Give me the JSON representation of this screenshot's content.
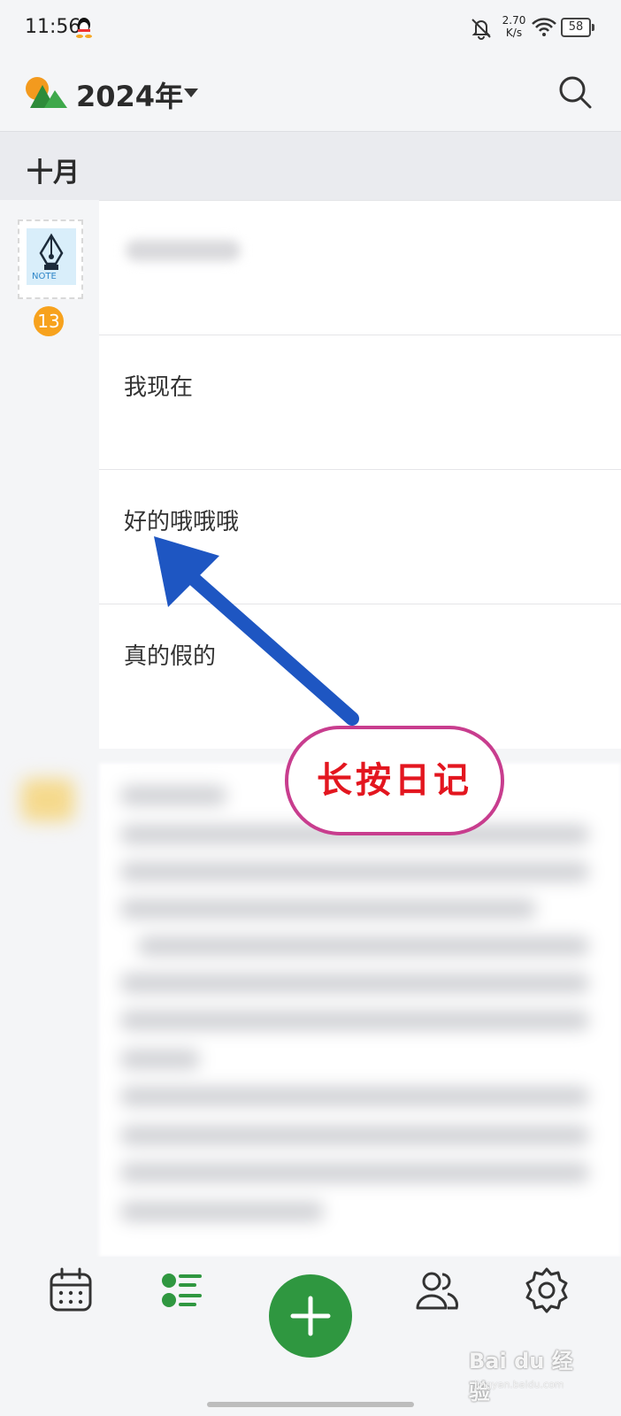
{
  "status": {
    "time": "11:56",
    "net_speed_value": "2.70",
    "net_speed_unit": "K/s",
    "battery": "58"
  },
  "header": {
    "year": "2024年"
  },
  "month_label": "十月",
  "note_badge": {
    "label": "NOTE",
    "count": "13"
  },
  "entries": [
    {
      "text": ""
    },
    {
      "text": "我现在"
    },
    {
      "text": "好的哦哦哦"
    },
    {
      "text": "真的假的"
    }
  ],
  "annotation": {
    "callout": "长按日记"
  },
  "watermark": {
    "brand": "Bai du 经验",
    "url": "jingyan.baidu.com"
  },
  "colors": {
    "accent_green": "#2f9740",
    "badge_orange": "#f7a21d",
    "arrow_blue": "#1e56c2",
    "callout_border": "#c83d8e",
    "callout_text": "#e3161f"
  },
  "icons": {
    "bottom_nav": [
      "calendar-icon",
      "list-icon",
      "plus-icon",
      "people-icon",
      "gear-icon"
    ]
  }
}
